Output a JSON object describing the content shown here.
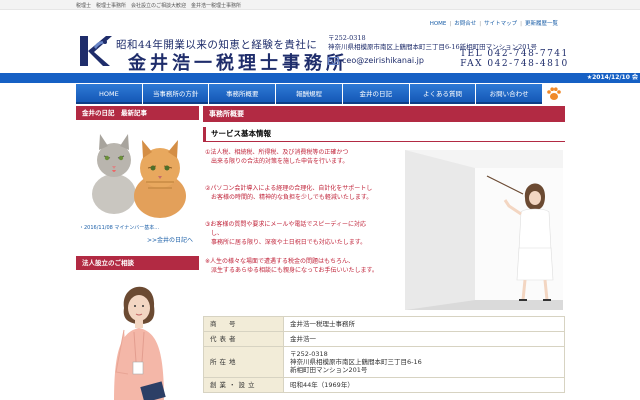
{
  "keywords": "税理士　税理士事務所　会社設立のご相談大歓迎　金井浩一税理士事務所",
  "top_nav": {
    "home": "HOME",
    "contact": "お問合せ",
    "sitemap": "サイトマップ",
    "history": "更新履歴一覧"
  },
  "header": {
    "tagline": "昭和44年開業以来の知恵と経験を貴社に",
    "firm_name": "金井浩一税理士事務所",
    "zip": "〒252-0318",
    "address": "神奈川県相模原市南区上鶴間本町三丁目6-16新相町田マンション201号",
    "email": "ceo@zeirishikanai.jp",
    "tel": "TEL 042-748-7741",
    "fax": "FAX 042-748-4810"
  },
  "news_ticker": "★2014/12/10 会",
  "global_nav": [
    "HOME",
    "当事務所の方針",
    "事務所概要",
    "報酬規程",
    "金井の日記",
    "よくある質問",
    "お問い合わせ"
  ],
  "sidebar": {
    "diary_title": "金井の日記　最新記事",
    "recent_entry": "・2016/11/08 マイナンバー基本...",
    "more_link": ">>金井の日記へ",
    "setup_title": "法人設立のご相談"
  },
  "main": {
    "section_title": "事務所概要",
    "subsection_title": "サービス基本情報",
    "paragraphs": [
      [
        "①法人税、相続税、所得税、及び消費税等の正確かつ",
        "　出来る限りの合法的対策を施した申告を行います。"
      ],
      [
        "②パソコン会計導入による経理の合理化、自計化をサポートし",
        "　お客様の時間的、精神的な負担を少しでも軽減いたします。"
      ],
      [
        "③お客様の質問や要求にメールや電話でスピーディーに対応",
        "　し、",
        "　事務所に居る限り、深夜や土日祝日でも対応いたします。"
      ],
      [
        "※人生の様々な場面で遭遇する税金の問題はもちろん、",
        "　派生するあらゆる相談にも親身になってお手伝いいたします。"
      ]
    ]
  },
  "info_table": [
    {
      "label": "商　号",
      "value": [
        "金井浩一税理士事務所"
      ]
    },
    {
      "label": "代表者",
      "value": [
        "金井浩一"
      ]
    },
    {
      "label": "所在地",
      "value": [
        "〒252-0318",
        "神奈川県相模原市南区上鶴間本町三丁目6-16",
        "新相町田マンション201号"
      ]
    },
    {
      "label": "創業・設立",
      "value": [
        "昭和44年（1969年）"
      ]
    }
  ],
  "colors": {
    "navy": "#1f2d6b",
    "nav_blue": "#1660c4",
    "accent_red": "#b22a43",
    "text_red": "#c0243a",
    "table_header": "#f2ecd8"
  }
}
